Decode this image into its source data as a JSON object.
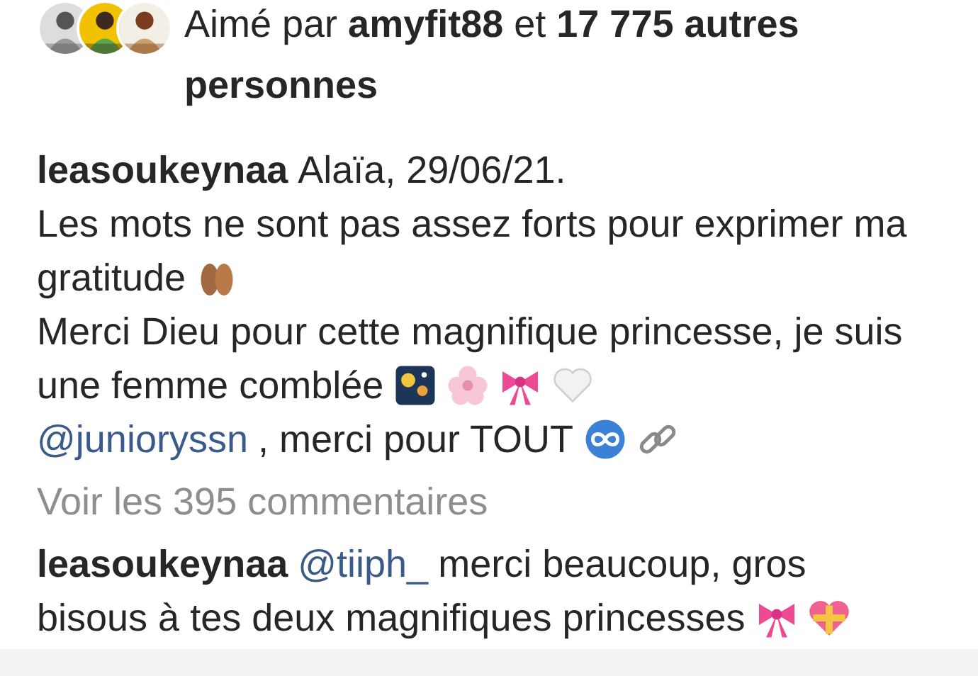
{
  "likes": {
    "text": "Aimé par **amyfit88** et **17 775 autres personnes**"
  },
  "caption": {
    "username": "leasoukeynaa",
    "lines": [
      [
        {
          "kind": "text",
          "text": "Alaïa, 29/06/21."
        }
      ],
      [
        {
          "kind": "text",
          "text": "Les mots ne sont pas assez forts pour exprimer ma"
        }
      ],
      [
        {
          "kind": "text",
          "text": "gratitude"
        },
        {
          "kind": "hands"
        }
      ],
      [
        {
          "kind": "text",
          "text": "Merci Dieu pour cette magnifique princesse, je suis"
        }
      ],
      [
        {
          "kind": "text",
          "text": "une femme comblée"
        },
        {
          "kind": "fireworks"
        },
        {
          "kind": "blossom"
        },
        {
          "kind": "bow"
        },
        {
          "kind": "heart"
        }
      ],
      [
        {
          "kind": "mention",
          "text": "@junioryssn"
        },
        {
          "kind": "text",
          "text": ", merci pour TOUT"
        },
        {
          "kind": "infinity"
        },
        {
          "kind": "link"
        }
      ]
    ]
  },
  "view_comments": "Voir les 395 commentaires",
  "comment": {
    "username": "leasoukeynaa",
    "lines": [
      [
        {
          "kind": "mention",
          "text": "@tiiph_"
        },
        {
          "kind": "text",
          "text": "merci beaucoup, gros"
        }
      ],
      [
        {
          "kind": "text",
          "text": "bisous à tes deux magnifiques princesses"
        },
        {
          "kind": "bow"
        },
        {
          "kind": "gift-heart"
        }
      ]
    ]
  }
}
